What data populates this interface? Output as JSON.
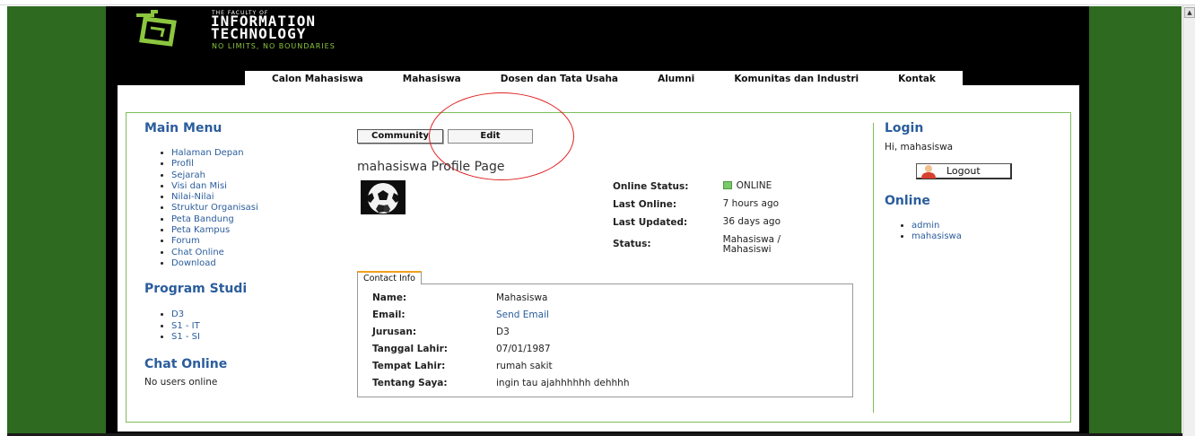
{
  "header": {
    "logo_small": "THE FACULTY OF",
    "logo_line1": "INFORMATION",
    "logo_line2": "TECHNOLOGY",
    "logo_tag": "NO LIMITS, NO BOUNDARIES"
  },
  "nav": [
    "Calon Mahasiswa",
    "Mahasiswa",
    "Dosen dan Tata Usaha",
    "Alumni",
    "Komunitas dan Industri",
    "Kontak"
  ],
  "main_menu": {
    "title": "Main Menu",
    "items": [
      "Halaman Depan",
      "Profil",
      "Sejarah",
      "Visi dan Misi",
      "Nilai-Nilai",
      "Struktur Organisasi",
      "Peta Bandung",
      "Peta Kampus",
      "Forum",
      "Chat Online",
      "Download"
    ]
  },
  "program_studi": {
    "title": "Program Studi",
    "items": [
      "D3",
      "S1 - IT",
      "S1 - SI"
    ]
  },
  "chat_online": {
    "title": "Chat Online",
    "text": "No users online"
  },
  "profile": {
    "tabs": {
      "community": "Community",
      "edit": "Edit"
    },
    "title": "mahasiswa Profile Page",
    "avatar_icon": "soccer-ball-icon",
    "status": {
      "online_status_label": "Online Status:",
      "online_status_value": "ONLINE",
      "last_online_label": "Last Online:",
      "last_online_value": "7 hours ago",
      "last_updated_label": "Last Updated:",
      "last_updated_value": "36 days ago",
      "status_label": "Status:",
      "status_value": "Mahasiswa / Mahasiswi"
    },
    "contact_tab": "Contact Info",
    "contact": {
      "name_label": "Name:",
      "name_value": "Mahasiswa",
      "email_label": "Email:",
      "email_value": "Send Email",
      "jurusan_label": "Jurusan:",
      "jurusan_value": "D3",
      "tanggal_label": "Tanggal Lahir:",
      "tanggal_value": "07/01/1987",
      "tempat_label": "Tempat Lahir:",
      "tempat_value": "rumah sakit",
      "tentang_label": "Tentang Saya:",
      "tentang_value": "ingin tau ajahhhhhh dehhhh"
    }
  },
  "login": {
    "title": "Login",
    "greeting": "Hi, mahasiswa",
    "logout_label": "Logout",
    "online_title": "Online",
    "online_users": [
      "admin",
      "mahasiswa"
    ]
  },
  "colors": {
    "side_green": "#2e6a1f",
    "link_blue": "#2b5d9c",
    "frame_green": "#7fbe5a",
    "annotation_red": "#e02020",
    "online_green": "#3e9c2a"
  }
}
